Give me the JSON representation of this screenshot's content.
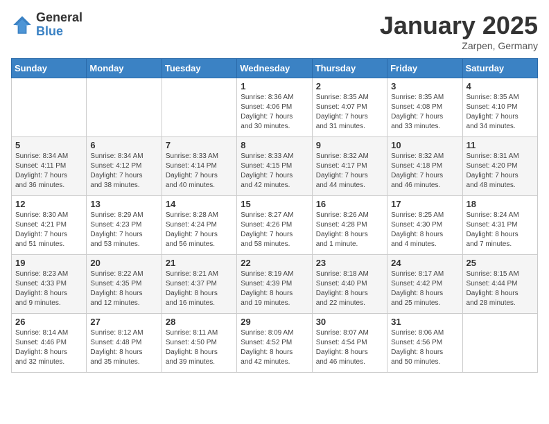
{
  "logo": {
    "general": "General",
    "blue": "Blue"
  },
  "title": "January 2025",
  "location": "Zarpen, Germany",
  "days_of_week": [
    "Sunday",
    "Monday",
    "Tuesday",
    "Wednesday",
    "Thursday",
    "Friday",
    "Saturday"
  ],
  "weeks": [
    [
      {
        "day": "",
        "info": ""
      },
      {
        "day": "",
        "info": ""
      },
      {
        "day": "",
        "info": ""
      },
      {
        "day": "1",
        "info": "Sunrise: 8:36 AM\nSunset: 4:06 PM\nDaylight: 7 hours\nand 30 minutes."
      },
      {
        "day": "2",
        "info": "Sunrise: 8:35 AM\nSunset: 4:07 PM\nDaylight: 7 hours\nand 31 minutes."
      },
      {
        "day": "3",
        "info": "Sunrise: 8:35 AM\nSunset: 4:08 PM\nDaylight: 7 hours\nand 33 minutes."
      },
      {
        "day": "4",
        "info": "Sunrise: 8:35 AM\nSunset: 4:10 PM\nDaylight: 7 hours\nand 34 minutes."
      }
    ],
    [
      {
        "day": "5",
        "info": "Sunrise: 8:34 AM\nSunset: 4:11 PM\nDaylight: 7 hours\nand 36 minutes."
      },
      {
        "day": "6",
        "info": "Sunrise: 8:34 AM\nSunset: 4:12 PM\nDaylight: 7 hours\nand 38 minutes."
      },
      {
        "day": "7",
        "info": "Sunrise: 8:33 AM\nSunset: 4:14 PM\nDaylight: 7 hours\nand 40 minutes."
      },
      {
        "day": "8",
        "info": "Sunrise: 8:33 AM\nSunset: 4:15 PM\nDaylight: 7 hours\nand 42 minutes."
      },
      {
        "day": "9",
        "info": "Sunrise: 8:32 AM\nSunset: 4:17 PM\nDaylight: 7 hours\nand 44 minutes."
      },
      {
        "day": "10",
        "info": "Sunrise: 8:32 AM\nSunset: 4:18 PM\nDaylight: 7 hours\nand 46 minutes."
      },
      {
        "day": "11",
        "info": "Sunrise: 8:31 AM\nSunset: 4:20 PM\nDaylight: 7 hours\nand 48 minutes."
      }
    ],
    [
      {
        "day": "12",
        "info": "Sunrise: 8:30 AM\nSunset: 4:21 PM\nDaylight: 7 hours\nand 51 minutes."
      },
      {
        "day": "13",
        "info": "Sunrise: 8:29 AM\nSunset: 4:23 PM\nDaylight: 7 hours\nand 53 minutes."
      },
      {
        "day": "14",
        "info": "Sunrise: 8:28 AM\nSunset: 4:24 PM\nDaylight: 7 hours\nand 56 minutes."
      },
      {
        "day": "15",
        "info": "Sunrise: 8:27 AM\nSunset: 4:26 PM\nDaylight: 7 hours\nand 58 minutes."
      },
      {
        "day": "16",
        "info": "Sunrise: 8:26 AM\nSunset: 4:28 PM\nDaylight: 8 hours\nand 1 minute."
      },
      {
        "day": "17",
        "info": "Sunrise: 8:25 AM\nSunset: 4:30 PM\nDaylight: 8 hours\nand 4 minutes."
      },
      {
        "day": "18",
        "info": "Sunrise: 8:24 AM\nSunset: 4:31 PM\nDaylight: 8 hours\nand 7 minutes."
      }
    ],
    [
      {
        "day": "19",
        "info": "Sunrise: 8:23 AM\nSunset: 4:33 PM\nDaylight: 8 hours\nand 9 minutes."
      },
      {
        "day": "20",
        "info": "Sunrise: 8:22 AM\nSunset: 4:35 PM\nDaylight: 8 hours\nand 12 minutes."
      },
      {
        "day": "21",
        "info": "Sunrise: 8:21 AM\nSunset: 4:37 PM\nDaylight: 8 hours\nand 16 minutes."
      },
      {
        "day": "22",
        "info": "Sunrise: 8:19 AM\nSunset: 4:39 PM\nDaylight: 8 hours\nand 19 minutes."
      },
      {
        "day": "23",
        "info": "Sunrise: 8:18 AM\nSunset: 4:40 PM\nDaylight: 8 hours\nand 22 minutes."
      },
      {
        "day": "24",
        "info": "Sunrise: 8:17 AM\nSunset: 4:42 PM\nDaylight: 8 hours\nand 25 minutes."
      },
      {
        "day": "25",
        "info": "Sunrise: 8:15 AM\nSunset: 4:44 PM\nDaylight: 8 hours\nand 28 minutes."
      }
    ],
    [
      {
        "day": "26",
        "info": "Sunrise: 8:14 AM\nSunset: 4:46 PM\nDaylight: 8 hours\nand 32 minutes."
      },
      {
        "day": "27",
        "info": "Sunrise: 8:12 AM\nSunset: 4:48 PM\nDaylight: 8 hours\nand 35 minutes."
      },
      {
        "day": "28",
        "info": "Sunrise: 8:11 AM\nSunset: 4:50 PM\nDaylight: 8 hours\nand 39 minutes."
      },
      {
        "day": "29",
        "info": "Sunrise: 8:09 AM\nSunset: 4:52 PM\nDaylight: 8 hours\nand 42 minutes."
      },
      {
        "day": "30",
        "info": "Sunrise: 8:07 AM\nSunset: 4:54 PM\nDaylight: 8 hours\nand 46 minutes."
      },
      {
        "day": "31",
        "info": "Sunrise: 8:06 AM\nSunset: 4:56 PM\nDaylight: 8 hours\nand 50 minutes."
      },
      {
        "day": "",
        "info": ""
      }
    ]
  ]
}
